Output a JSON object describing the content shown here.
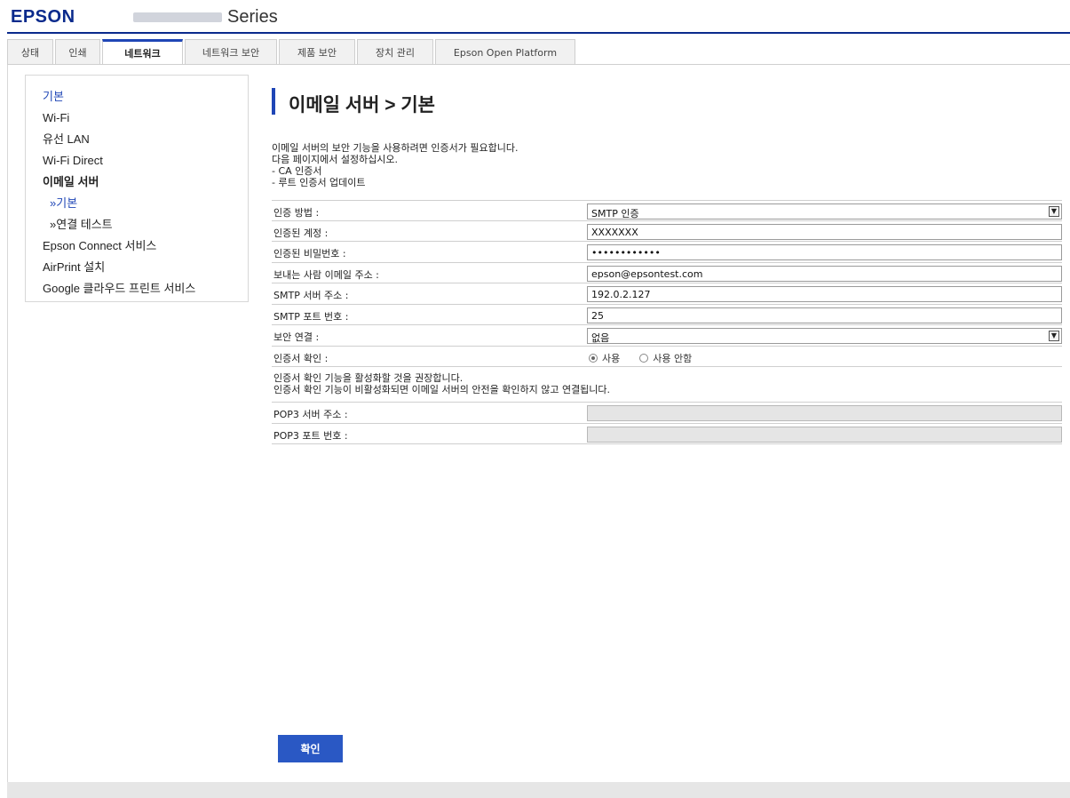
{
  "header": {
    "brand": "EPSON",
    "series": "Series"
  },
  "tabs": [
    {
      "label": "상태",
      "active": false
    },
    {
      "label": "인쇄",
      "active": false
    },
    {
      "label": "네트워크",
      "active": true
    },
    {
      "label": "네트워크 보안",
      "active": false
    },
    {
      "label": "제품 보안",
      "active": false
    },
    {
      "label": "장치 관리",
      "active": false
    },
    {
      "label": "Epson Open Platform",
      "active": false
    }
  ],
  "sidebar": {
    "items": [
      {
        "label": "기본",
        "current": true
      },
      {
        "label": "Wi-Fi"
      },
      {
        "label": "유선 LAN"
      },
      {
        "label": "Wi-Fi Direct"
      },
      {
        "label": "이메일 서버",
        "bold": true
      },
      {
        "label": "»기본",
        "current": true,
        "sub": true
      },
      {
        "label": "»연결 테스트",
        "sub": true
      },
      {
        "label": "Epson Connect 서비스"
      },
      {
        "label": "AirPrint 설치"
      },
      {
        "label": "Google 클라우드 프린트 서비스"
      }
    ]
  },
  "page": {
    "title": "이메일 서버 > 기본",
    "notice": [
      "이메일 서버의 보안 기능을 사용하려면 인증서가 필요합니다.",
      "다음 페이지에서 설정하십시오.",
      "- CA 인증서",
      "- 루트 인증서 업데이트"
    ]
  },
  "form": {
    "auth_method": {
      "label": "인증 방법 :",
      "value": "SMTP 인증"
    },
    "auth_account": {
      "label": "인증된 계정 :",
      "value": "XXXXXXX"
    },
    "auth_password": {
      "label": "인증된 비밀번호 :",
      "value": "••••••••••••"
    },
    "sender_email": {
      "label": "보내는 사람 이메일 주소 :",
      "value": "epson@epsontest.com"
    },
    "smtp_address": {
      "label": "SMTP 서버 주소 :",
      "value": "192.0.2.127"
    },
    "smtp_port": {
      "label": "SMTP 포트 번호 :",
      "value": "25"
    },
    "secure_connection": {
      "label": "보안 연결 :",
      "value": "없음"
    },
    "cert_validation": {
      "label": "인증서 확인 :",
      "option_on": "사용",
      "option_off": "사용 안함",
      "selected": "사용"
    },
    "cert_note": [
      "인증서 확인 기능을 활성화할 것을 권장합니다.",
      "인증서 확인 기능이 비활성화되면 이메일 서버의 안전을 확인하지 않고 연결됩니다."
    ],
    "pop3_address": {
      "label": "POP3 서버 주소 :",
      "value": ""
    },
    "pop3_port": {
      "label": "POP3 포트 번호 :",
      "value": ""
    }
  },
  "actions": {
    "ok_label": "확인"
  },
  "colors": {
    "brand": "#0a2a8c",
    "accent": "#1f46b6",
    "button": "#2a58c4"
  }
}
